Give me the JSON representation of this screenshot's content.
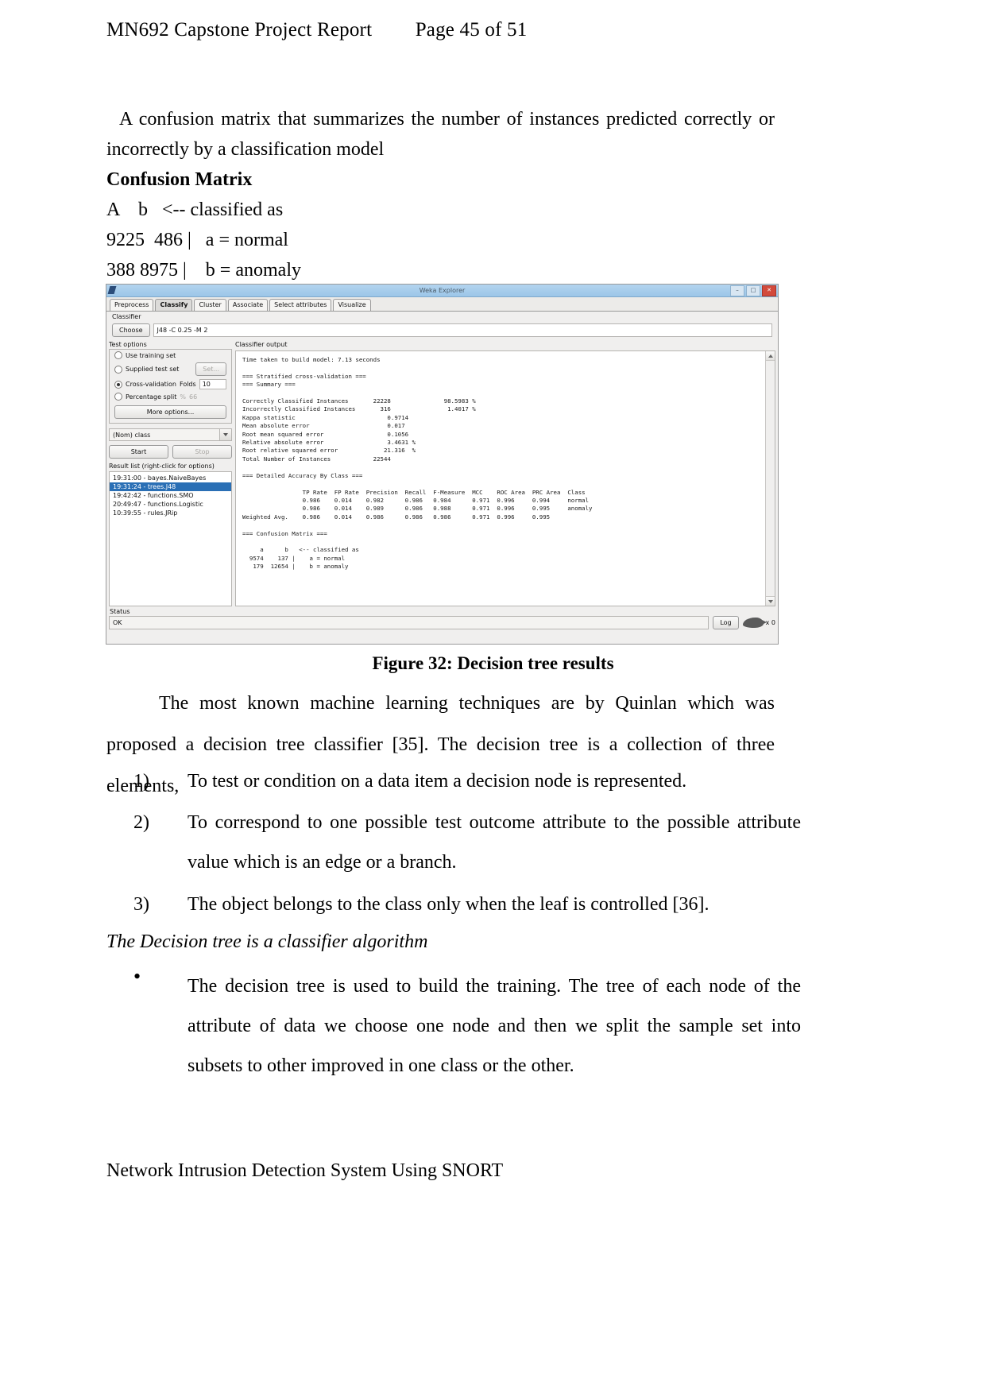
{
  "header": {
    "title": "MN692 Capstone Project Report",
    "page": "Page 45 of 51"
  },
  "body": {
    "intro": "A confusion matrix that summarizes the number of instances predicted correctly or incorrectly by a classification model",
    "cm_heading": "Confusion Matrix",
    "cm_header_row": "A    b   <-- classified as",
    "cm_row_a": "9225  486 |   a = normal",
    "cm_row_b": "388 8975 |    b = anomaly",
    "figure_caption": "Figure 32: Decision tree results",
    "para2": "The most known machine learning techniques are by Quinlan which was proposed a decision tree classifier [35]. The decision tree is a collection of three elements,",
    "numbered": [
      {
        "num": "1)",
        "text": "To test or condition on a data item a decision node is represented."
      },
      {
        "num": "2)",
        "text": "To correspond to one possible test outcome attribute to the possible attribute value which is an edge or a branch."
      },
      {
        "num": "3)",
        "text": "The object belongs to the class only when the leaf is controlled [36]."
      }
    ],
    "italic_line": "The Decision tree is a classifier algorithm",
    "bullet": "The decision tree is used to build the training. The tree of each node of the attribute of data we choose one node and then we split the sample set into subsets to other improved in one class or the other.",
    "bullet_glyph": "•"
  },
  "footer": {
    "text": "Network Intrusion Detection System Using SNORT"
  },
  "weka": {
    "title": "Weka Explorer",
    "window_buttons": [
      {
        "name": "minimize",
        "glyph": "–"
      },
      {
        "name": "maximize",
        "glyph": "□"
      },
      {
        "name": "close",
        "glyph": "✕"
      }
    ],
    "tabs": [
      {
        "label": "Preprocess",
        "active": false
      },
      {
        "label": "Classify",
        "active": true
      },
      {
        "label": "Cluster",
        "active": false
      },
      {
        "label": "Associate",
        "active": false
      },
      {
        "label": "Select attributes",
        "active": false
      },
      {
        "label": "Visualize",
        "active": false
      }
    ],
    "classifier_label": "Classifier",
    "choose_button": "Choose",
    "choose_value": "J48 -C 0.25 -M 2",
    "test_options": {
      "title": "Test options",
      "use_training_set": "Use training set",
      "supplied_test_set": "Supplied test set",
      "set_button": "Set...",
      "cross_validation": "Cross-validation",
      "folds_label": "Folds",
      "folds_value": "10",
      "percentage_split": "Percentage split",
      "percent_symbol": "%",
      "percent_value": "66",
      "more_options": "More options..."
    },
    "class_combo": "(Nom) class",
    "start_button": "Start",
    "stop_button": "Stop",
    "result_list_label": "Result list (right-click for options)",
    "result_list": [
      {
        "label": "19:31:00 - bayes.NaiveBayes",
        "selected": false
      },
      {
        "label": "19:31:24 - trees.J48",
        "selected": true
      },
      {
        "label": "19:42:42 - functions.SMO",
        "selected": false
      },
      {
        "label": "20:49:47 - functions.Logistic",
        "selected": false
      },
      {
        "label": "10:39:55 - rules.JRip",
        "selected": false
      }
    ],
    "output_label": "Classifier output",
    "output_text": "Time taken to build model: 7.13 seconds\n\n=== Stratified cross-validation ===\n=== Summary ===\n\nCorrectly Classified Instances       22228               98.5983 %\nIncorrectly Classified Instances       316                1.4017 %\nKappa statistic                          0.9714\nMean absolute error                      0.017\nRoot mean squared error                  0.1056\nRelative absolute error                  3.4631 %\nRoot relative squared error             21.316  %\nTotal Number of Instances            22544\n\n=== Detailed Accuracy By Class ===\n\n                 TP Rate  FP Rate  Precision  Recall  F-Measure  MCC    ROC Area  PRC Area  Class\n                 0.986    0.014    0.982      0.986   0.984      0.971  0.996     0.994     normal\n                 0.986    0.014    0.989      0.986   0.988      0.971  0.996     0.995     anomaly\nWeighted Avg.    0.986    0.014    0.986      0.986   0.986      0.971  0.996     0.995\n\n=== Confusion Matrix ===\n\n     a      b   <-- classified as\n  9574    137 |    a = normal\n   179  12654 |    b = anomaly",
    "status_label": "Status",
    "status_value": "OK",
    "log_button": "Log",
    "weka_bird_count": "x 0"
  }
}
